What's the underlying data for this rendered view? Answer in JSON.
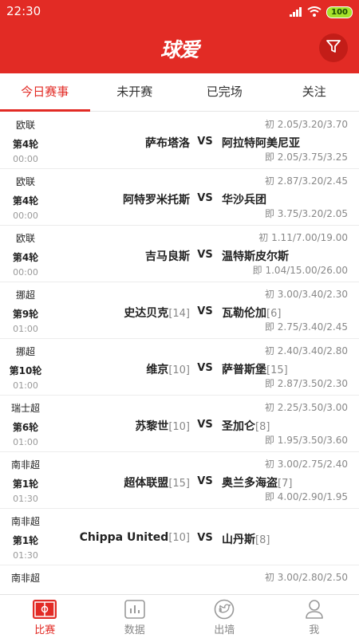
{
  "status": {
    "time": "22:30",
    "battery": "100"
  },
  "header": {
    "logo": "球爱"
  },
  "tabs": [
    "今日赛事",
    "未开赛",
    "已完场",
    "关注"
  ],
  "matches": [
    {
      "league": "欧联",
      "round": "第4轮",
      "time": "00:00",
      "home": "萨布塔洛",
      "home_rank": "",
      "away": "阿拉特阿美尼亚",
      "away_rank": "",
      "odds_init": "初 2.05/3.20/3.70",
      "odds_live": "即 2.05/3.75/3.25"
    },
    {
      "league": "欧联",
      "round": "第4轮",
      "time": "00:00",
      "home": "阿特罗米托斯",
      "home_rank": "",
      "away": "华沙兵团",
      "away_rank": "",
      "odds_init": "初 2.87/3.20/2.45",
      "odds_live": "即 3.75/3.20/2.05"
    },
    {
      "league": "欧联",
      "round": "第4轮",
      "time": "00:00",
      "home": "吉马良斯",
      "home_rank": "",
      "away": "温特斯皮尔斯",
      "away_rank": "",
      "odds_init": "初 1.11/7.00/19.00",
      "odds_live": "即 1.04/15.00/26.00"
    },
    {
      "league": "挪超",
      "round": "第9轮",
      "time": "01:00",
      "home": "史达贝克",
      "home_rank": "[14]",
      "away": "瓦勒伦加",
      "away_rank": "[6]",
      "odds_init": "初 3.00/3.40/2.30",
      "odds_live": "即 2.75/3.40/2.45"
    },
    {
      "league": "挪超",
      "round": "第10轮",
      "time": "01:00",
      "home": "维京",
      "home_rank": "[10]",
      "away": "萨普斯堡",
      "away_rank": "[15]",
      "odds_init": "初 2.40/3.40/2.80",
      "odds_live": "即 2.87/3.50/2.30"
    },
    {
      "league": "瑞士超",
      "round": "第6轮",
      "time": "01:00",
      "home": "苏黎世",
      "home_rank": "[10]",
      "away": "圣加仑",
      "away_rank": "[8]",
      "odds_init": "初 2.25/3.50/3.00",
      "odds_live": "即 1.95/3.50/3.60"
    },
    {
      "league": "南非超",
      "round": "第1轮",
      "time": "01:30",
      "home": "超体联盟",
      "home_rank": "[15]",
      "away": "奥兰多海盗",
      "away_rank": "[7]",
      "odds_init": "初 3.00/2.75/2.40",
      "odds_live": "即 4.00/2.90/1.95"
    },
    {
      "league": "南非超",
      "round": "第1轮",
      "time": "01:30",
      "home": "Chippa United",
      "home_rank": "[10]",
      "away": "山丹斯",
      "away_rank": "[8]",
      "odds_init": "",
      "odds_live": ""
    },
    {
      "league": "南非超",
      "round": "",
      "time": "",
      "home": "",
      "home_rank": "",
      "away": "",
      "away_rank": "",
      "odds_init": "初 3.00/2.80/2.50",
      "odds_live": ""
    }
  ],
  "vs_label": "VS",
  "nav": [
    "比赛",
    "数据",
    "出墙",
    "我"
  ],
  "colors": {
    "primary": "#e22b25",
    "muted": "#888888"
  },
  "icons": {
    "signal": "signal-icon",
    "wifi": "wifi-icon",
    "filter": "filter-icon",
    "match": "pitch-icon",
    "data": "chart-icon",
    "wall": "bird-icon",
    "me": "user-icon"
  }
}
